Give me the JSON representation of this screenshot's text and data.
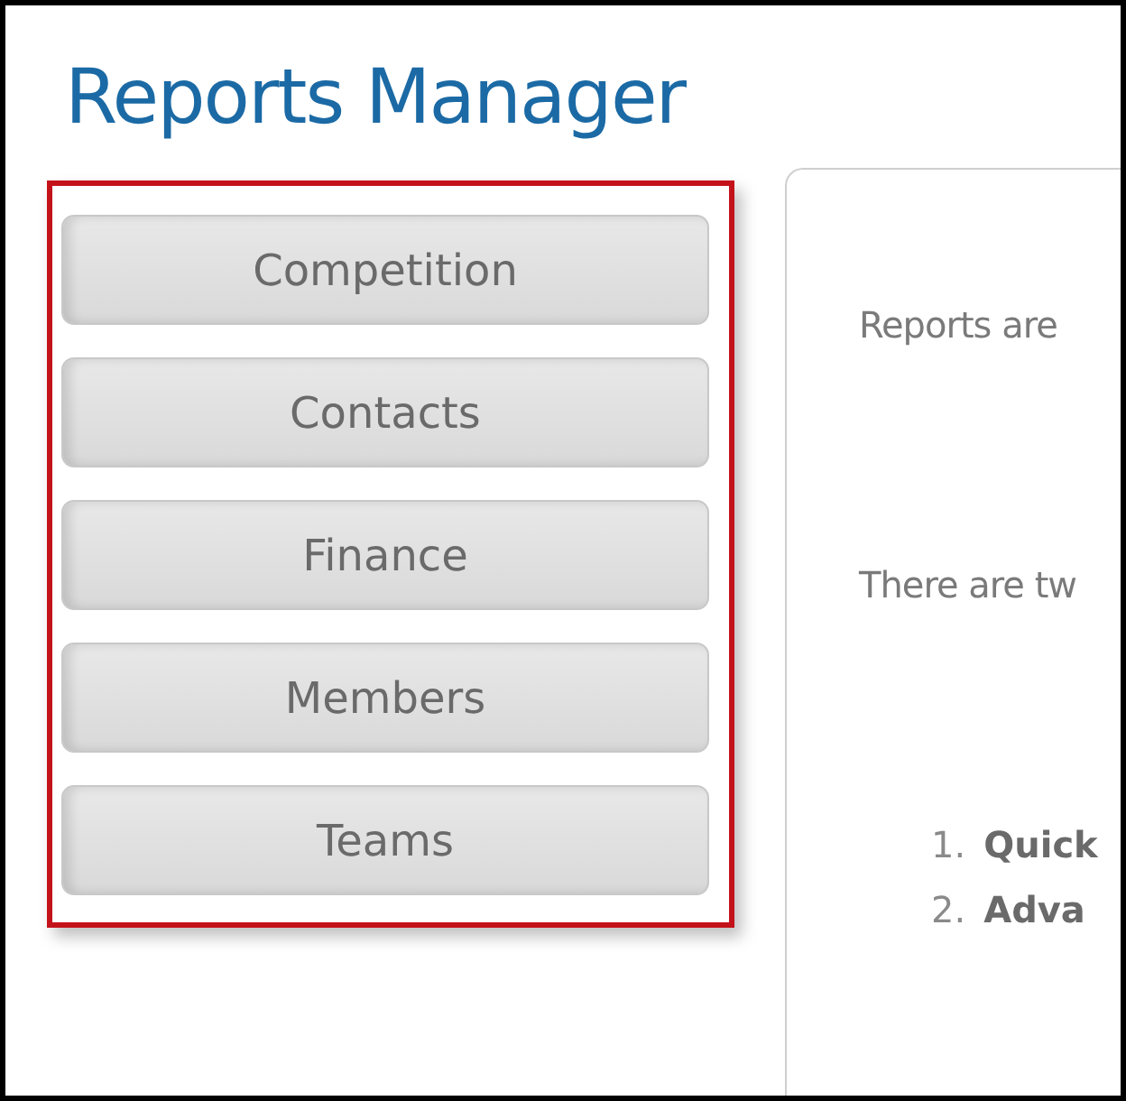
{
  "title": "Reports Manager",
  "sidebar": {
    "items": [
      {
        "label": "Competition"
      },
      {
        "label": "Contacts"
      },
      {
        "label": "Finance"
      },
      {
        "label": "Members"
      },
      {
        "label": "Teams"
      }
    ]
  },
  "content": {
    "paragraphs": [
      "Reports are",
      "There are tw"
    ],
    "list": [
      {
        "number": "1.",
        "text": "Quick"
      },
      {
        "number": "2.",
        "text": "Adva"
      }
    ]
  }
}
